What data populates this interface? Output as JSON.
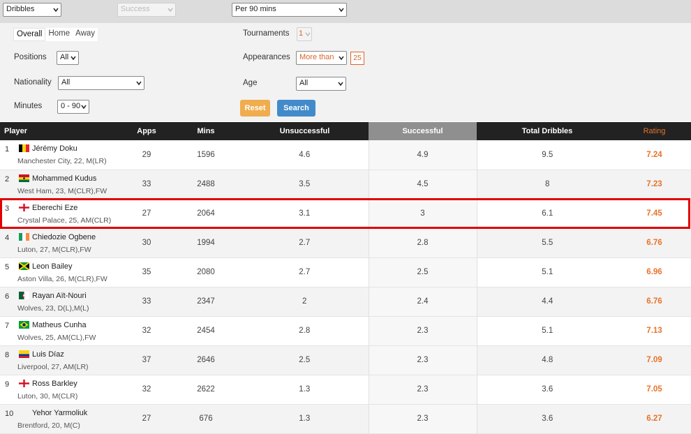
{
  "top": {
    "category": "Dribbles",
    "subcategory": "Success",
    "per": "Per 90 mins"
  },
  "filters": {
    "tabs": [
      "Overall",
      "Home",
      "Away"
    ],
    "positions_label": "Positions",
    "positions_value": "All",
    "nationality_label": "Nationality",
    "nationality_value": "All",
    "minutes_label": "Minutes",
    "minutes_value": "0 - 90",
    "tournaments_label": "Tournaments",
    "tournaments_value": "1",
    "appearances_label": "Appearances",
    "appearances_value": "More than",
    "appearances_count": "25",
    "age_label": "Age",
    "age_value": "All",
    "reset_label": "Reset",
    "search_label": "Search"
  },
  "table": {
    "headers": [
      "Player",
      "Apps",
      "Mins",
      "Unsuccessful",
      "Successful",
      "Total Dribbles",
      "Rating"
    ],
    "highlight_color": "#e00000",
    "rating_color": "#e8732a",
    "rows": [
      {
        "rank": "1",
        "name": "Jérémy Doku",
        "meta": "Manchester City,  22, M(LR)",
        "flag": "belgium-flag-icon",
        "apps": "29",
        "mins": "1596",
        "unsucc": "4.6",
        "succ": "4.9",
        "total": "9.5",
        "rating": "7.24"
      },
      {
        "rank": "2",
        "name": "Mohammed Kudus",
        "meta": "West Ham,  23, M(CLR),FW",
        "flag": "ghana-flag-icon",
        "apps": "33",
        "mins": "2488",
        "unsucc": "3.5",
        "succ": "4.5",
        "total": "8",
        "rating": "7.23"
      },
      {
        "rank": "3",
        "name": "Eberechi Eze",
        "meta": "Crystal Palace,  25, AM(CLR)",
        "flag": "england-flag-icon",
        "apps": "27",
        "mins": "2064",
        "unsucc": "3.1",
        "succ": "3",
        "total": "6.1",
        "rating": "7.45"
      },
      {
        "rank": "4",
        "name": "Chiedozie Ogbene",
        "meta": "Luton,  27, M(CLR),FW",
        "flag": "ireland-flag-icon",
        "apps": "30",
        "mins": "1994",
        "unsucc": "2.7",
        "succ": "2.8",
        "total": "5.5",
        "rating": "6.76"
      },
      {
        "rank": "5",
        "name": "Leon Bailey",
        "meta": "Aston Villa,  26, M(CLR),FW",
        "flag": "jamaica-flag-icon",
        "apps": "35",
        "mins": "2080",
        "unsucc": "2.7",
        "succ": "2.5",
        "total": "5.1",
        "rating": "6.96"
      },
      {
        "rank": "6",
        "name": "Rayan Aït-Nouri",
        "meta": "Wolves,  23, D(L),M(L)",
        "flag": "algeria-flag-icon",
        "apps": "33",
        "mins": "2347",
        "unsucc": "2",
        "succ": "2.4",
        "total": "4.4",
        "rating": "6.76"
      },
      {
        "rank": "7",
        "name": "Matheus Cunha",
        "meta": "Wolves,  25, AM(CL),FW",
        "flag": "brazil-flag-icon",
        "apps": "32",
        "mins": "2454",
        "unsucc": "2.8",
        "succ": "2.3",
        "total": "5.1",
        "rating": "7.13"
      },
      {
        "rank": "8",
        "name": "Luis Díaz",
        "meta": "Liverpool,  27, AM(LR)",
        "flag": "colombia-flag-icon",
        "apps": "37",
        "mins": "2646",
        "unsucc": "2.5",
        "succ": "2.3",
        "total": "4.8",
        "rating": "7.09"
      },
      {
        "rank": "9",
        "name": "Ross Barkley",
        "meta": "Luton,  30, M(CLR)",
        "flag": "england-flag-icon",
        "apps": "32",
        "mins": "2622",
        "unsucc": "1.3",
        "succ": "2.3",
        "total": "3.6",
        "rating": "7.05"
      },
      {
        "rank": "10",
        "name": "Yehor Yarmoliuk",
        "meta": "Brentford,  20, M(C)",
        "flag": "",
        "apps": "27",
        "mins": "676",
        "unsucc": "1.3",
        "succ": "2.3",
        "total": "3.6",
        "rating": "6.27"
      }
    ]
  }
}
